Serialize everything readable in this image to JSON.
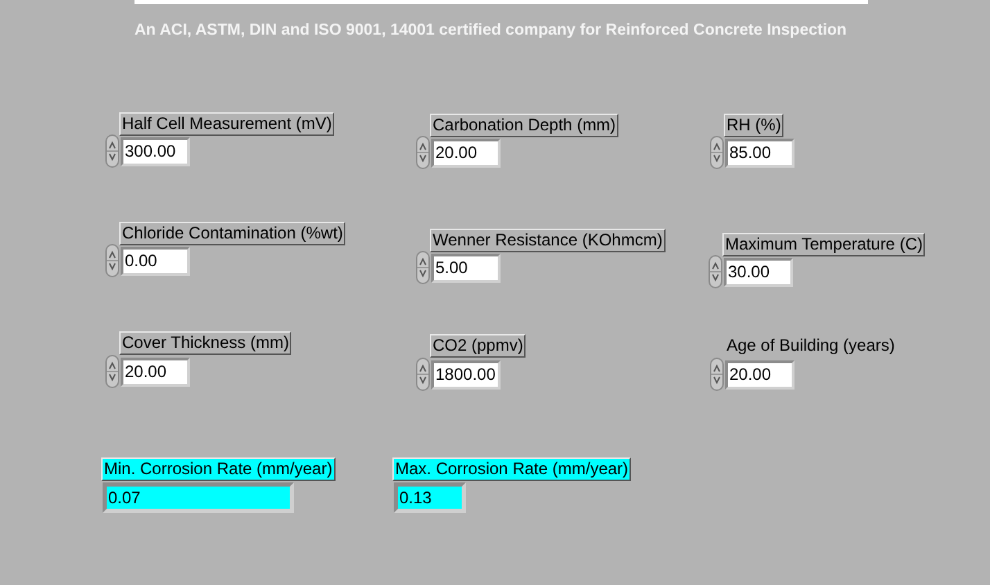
{
  "subtitle": "An ACI, ASTM, DIN and ISO 9001, 14001 certified company for Reinforced Concrete Inspection",
  "fields": [
    {
      "kind": "control",
      "label": "Half Cell Measurement (mV)",
      "label_framed": true,
      "value": "300.00"
    },
    {
      "kind": "control",
      "label": "Carbonation Depth (mm)",
      "label_framed": true,
      "value": "20.00"
    },
    {
      "kind": "control",
      "label": "RH (%)",
      "label_framed": true,
      "value": "85.00"
    },
    {
      "kind": "control",
      "label": "Chloride Contamination (%wt)",
      "label_framed": true,
      "value": "0.00"
    },
    {
      "kind": "control",
      "label": "Wenner Resistance (KOhmcm)",
      "label_framed": true,
      "value": "5.00"
    },
    {
      "kind": "control",
      "label": "Maximum Temperature (C)",
      "label_framed": true,
      "value": "30.00"
    },
    {
      "kind": "control",
      "label": "Cover Thickness (mm)",
      "label_framed": true,
      "value": "20.00"
    },
    {
      "kind": "control",
      "label": "CO2 (ppmv)",
      "label_framed": true,
      "value": "1800.00"
    },
    {
      "kind": "control",
      "label": "Age of Building (years)",
      "label_framed": false,
      "value": "20.00"
    },
    {
      "kind": "indicator",
      "label": "Min. Corrosion Rate (mm/year)",
      "label_framed": true,
      "value": "0.07"
    },
    {
      "kind": "indicator",
      "label": "Max. Corrosion Rate (mm/year)",
      "label_framed": true,
      "value": "0.13"
    }
  ]
}
